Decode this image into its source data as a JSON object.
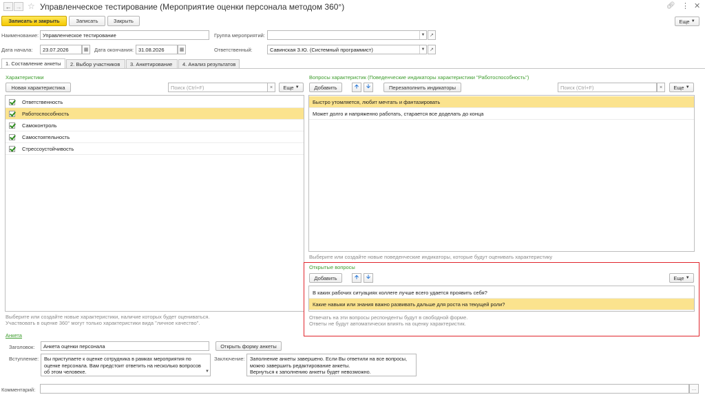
{
  "window": {
    "title": "Управленческое тестирование (Мероприятие оценки персонала методом 360°)"
  },
  "toolbar": {
    "save_close": "Записать и закрыть",
    "save": "Записать",
    "close": "Закрыть",
    "more": "Еще"
  },
  "header": {
    "name_label": "Наименование:",
    "name_value": "Управленческое тестирование",
    "group_label": "Группа мероприятий:",
    "group_value": "",
    "start_label": "Дата начала:",
    "start_value": "23.07.2026",
    "end_label": "Дата окончания:",
    "end_value": "31.08.2026",
    "resp_label": "Ответственный:",
    "resp_value": "Савинская З.Ю. (Системный программист)"
  },
  "tabs": [
    {
      "label": "1. Составление анкеты"
    },
    {
      "label": "2. Выбор участников"
    },
    {
      "label": "3. Анкетирование"
    },
    {
      "label": "4. Анализ результатов"
    }
  ],
  "characteristics": {
    "title": "Характеристики",
    "new_button": "Новая характеристика",
    "search_placeholder": "Поиск (Ctrl+F)",
    "more": "Еще",
    "items": [
      {
        "label": "Ответственность",
        "checked": true
      },
      {
        "label": "Работоспособность",
        "checked": true,
        "selected": true
      },
      {
        "label": "Самоконтроль",
        "checked": true
      },
      {
        "label": "Самостоятельность",
        "checked": true
      },
      {
        "label": "Стрессоустойчивость",
        "checked": true
      }
    ],
    "hint": "Выберите или создайте новые характеристики, наличие которых будет оцениваться.\nУчаствовать в оценке 360° могут только характеристики вида \"личное качество\"."
  },
  "questions": {
    "title": "Вопросы характеристик (Поведенческие индикаторы характеристики \"Работоспособность\")",
    "add_button": "Добавить",
    "refill_button": "Перезаполнить индикаторы",
    "search_placeholder": "Поиск (Ctrl+F)",
    "more": "Еще",
    "items": [
      {
        "label": "Быстро утомляется, любит мечтать и фантазировать",
        "selected": true
      },
      {
        "label": "Может долго и напряженно работать, старается все доделать до конца"
      }
    ],
    "hint": "Выберите или создайте новые поведенческие индикаторы, которые будут оценивать характеристику"
  },
  "open_questions": {
    "title": "Открытые вопросы",
    "add_button": "Добавить",
    "more": "Еще",
    "items": [
      {
        "label": "В каких рабочих ситуациях коллеге лучше всего удается проявить себя?"
      },
      {
        "label": "Какие навыки или знания важно развивать дальше для роста на текущей роли?",
        "selected": true
      }
    ],
    "hint": "Отвечать на эти вопросы респонденты будут в свободной форме.\nОтветы не будут автоматически влиять на оценку характеристик."
  },
  "survey": {
    "section_label": "Анкета",
    "title_label": "Заголовок:",
    "title_value": "Анкета оценки персонала",
    "open_form_button": "Открыть форму анкеты",
    "intro_label": "Вступление:",
    "intro_value": "Вы приступаете к оценке сотрудника в рамках мероприятия по оценке персонала. Вам предстоит ответить на несколько вопросов об этом человеке.",
    "conclusion_label": "Заключение:",
    "conclusion_value": "Заполнение анкеты завершено. Если Вы ответили на все вопросы, можно завершить редактирование анкеты.\nВернуться к заполнению анкеты будет невозможно."
  },
  "comment": {
    "label": "Комментарий:",
    "value": ""
  },
  "colors": {
    "accent_yellow": "#f5c800",
    "selection": "#fbe38e",
    "green_text": "#3c9c2c",
    "highlight_border": "#e0242b",
    "arrow_blue": "#2d7ad6"
  },
  "icons": [
    "back-arrow-icon",
    "forward-arrow-icon",
    "star-icon",
    "link-icon",
    "kebab-icon",
    "close-icon",
    "calendar-icon",
    "chevron-down-icon",
    "arrow-up-icon",
    "arrow-down-icon",
    "clear-icon",
    "ellipsis-icon"
  ]
}
